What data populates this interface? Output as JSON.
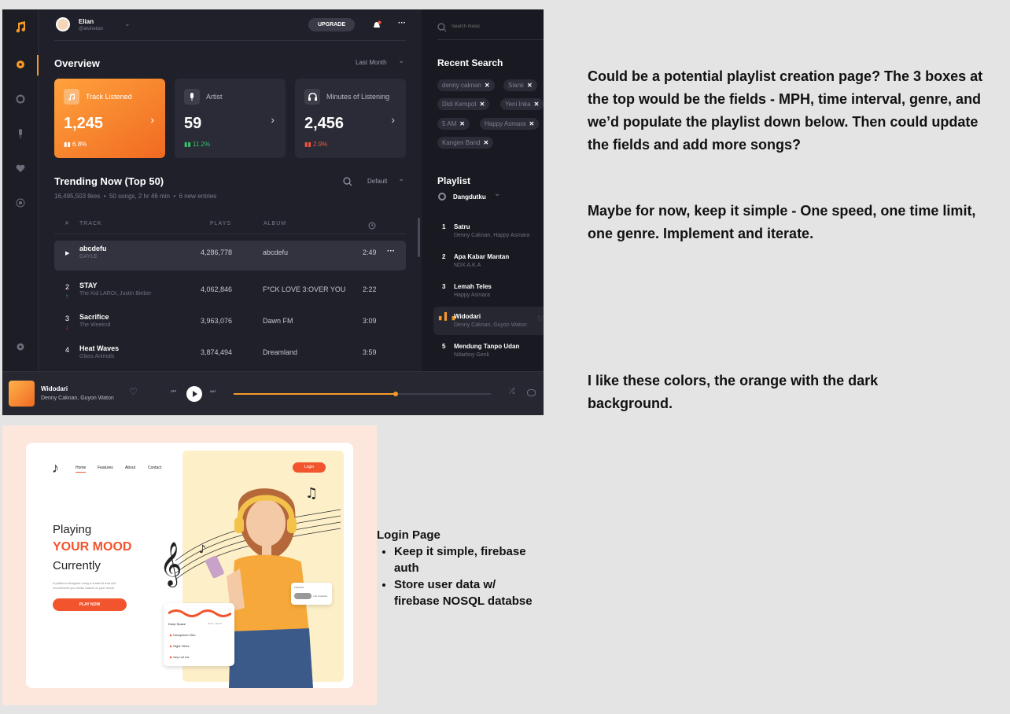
{
  "dashboard": {
    "user": {
      "name": "Elian",
      "handle": "@alvinelian"
    },
    "upgrade_label": "UPGRADE",
    "overview": {
      "title": "Overview",
      "period": "Last Month"
    },
    "stats": [
      {
        "label": "Track Listened",
        "value": "1,245",
        "change": "6.8%"
      },
      {
        "label": "Artist",
        "value": "59",
        "change": "11.2%"
      },
      {
        "label": "Minutes of Listening",
        "value": "2,456",
        "change": "2.9%"
      }
    ],
    "trending": {
      "title": "Trending Now (Top 50)",
      "meta": "16,495,503 likes  •  50 songs, 2 hr 46 min  •  6 new entries",
      "sort": "Default",
      "columns": {
        "num": "#",
        "track": "TRACK",
        "plays": "PLAYS",
        "album": "ALBUM"
      },
      "rows": [
        {
          "num": "",
          "track": "abcdefu",
          "artist": "GAYLE",
          "plays": "4,286,778",
          "album": "abcdefu",
          "duration": "2:49"
        },
        {
          "num": "2",
          "track": "STAY",
          "artist": "The Kid LAROI, Justin Bieber",
          "plays": "4,062,846",
          "album": "F*CK LOVE 3:OVER YOU",
          "duration": "2:22"
        },
        {
          "num": "3",
          "track": "Sacrifice",
          "artist": "The Weeknd",
          "plays": "3,963,076",
          "album": "Dawn FM",
          "duration": "3:09"
        },
        {
          "num": "4",
          "track": "Heat Waves",
          "artist": "Glass Animals",
          "plays": "3,874,494",
          "album": "Dreamland",
          "duration": "3:59"
        }
      ]
    },
    "search": {
      "placeholder": "Search music"
    },
    "recent": {
      "title": "Recent Search",
      "chips": [
        "denny caknan",
        "Slank",
        "Didi Kempot",
        "Yeni Inka",
        "5 AM",
        "Happy Asmara",
        "Kangen Band"
      ]
    },
    "playlist": {
      "title": "Playlist",
      "selected": "Dangdutku",
      "items": [
        {
          "num": "1",
          "title": "Satru",
          "artist": "Denny Caknan, Happy Asmara"
        },
        {
          "num": "2",
          "title": "Apa Kabar Mantan",
          "artist": "NDX A.K.A"
        },
        {
          "num": "3",
          "title": "Lemah Teles",
          "artist": "Happy Asmara"
        },
        {
          "num": "",
          "title": "Widodari",
          "artist": "Denny Caknan, Guyon Waton"
        },
        {
          "num": "5",
          "title": "Mendung Tanpo Udan",
          "artist": "Ndarboy Genk"
        }
      ]
    },
    "now_playing": {
      "title": "Widodari",
      "artist": "Denny Caknan, Guyon Waton",
      "progress": 0.63
    }
  },
  "notes": {
    "note1": "Could be a potential playlist creation page?  The 3 boxes at the top would be the fields - MPH, time interval, genre, and we’d populate the playlist down below. Then could update the fields and add more songs?",
    "note2": "Maybe for now, keep it simple - One speed, one time limit, one genre. Implement and iterate.",
    "note3": "I like these colors, the orange with the dark background."
  },
  "landing": {
    "nav": [
      "Home",
      "Features",
      "About",
      "Contact"
    ],
    "login": "Login",
    "hero1": "Playing",
    "hero2": "YOUR MOOD",
    "hero3": "Currently",
    "desc": "A platform designed using a smart AI that will recommend you music based on your mood",
    "cta": "PLAY NOW",
    "widget_title": "Deep Space",
    "widget_time": "00:01 / 03:48",
    "songs": [
      "Disciplined Vibe",
      "Night Vibes",
      "why not me"
    ],
    "side_title": "Favorites",
    "side_count": "+10 Listeners"
  },
  "login_notes": {
    "title": "Login Page",
    "b1": "Keep it simple, firebase auth",
    "b2": "Store user data w/ firebase NOSQL databse"
  },
  "colors": {
    "accent": "#f58a2a",
    "dark": "#1f2029"
  }
}
